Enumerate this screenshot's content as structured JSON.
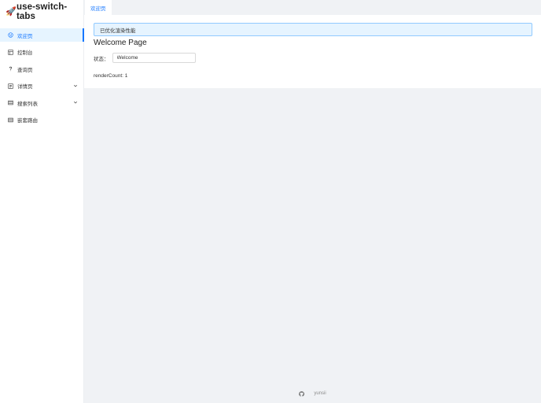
{
  "app": {
    "logo_emoji": "🚀",
    "title": "use-switch-tabs"
  },
  "sidebar": {
    "items": [
      {
        "label": "欢迎页",
        "icon": "smile-icon",
        "active": true,
        "has_submenu": false
      },
      {
        "label": "控制台",
        "icon": "dashboard-icon",
        "active": false,
        "has_submenu": false
      },
      {
        "label": "查询页",
        "icon": "question-icon",
        "active": false,
        "has_submenu": false
      },
      {
        "label": "详情页",
        "icon": "profile-icon",
        "active": false,
        "has_submenu": true
      },
      {
        "label": "搜索列表",
        "icon": "table-icon",
        "active": false,
        "has_submenu": true
      },
      {
        "label": "嵌套路由",
        "icon": "table-icon",
        "active": false,
        "has_submenu": false
      }
    ]
  },
  "tabs": [
    {
      "label": "欢迎页",
      "active": true
    }
  ],
  "main": {
    "alert_text": "已优化渲染性能",
    "title": "Welcome Page",
    "status_label": "状态：",
    "status_value": "Welcome",
    "render_count_text": "renderCount: 1"
  },
  "footer": {
    "icon": "github-icon",
    "author": "yunsii"
  },
  "colors": {
    "primary": "#1677ff",
    "active_bg": "#e6f4ff",
    "page_bg": "#f0f2f5",
    "alert_border": "#91caff"
  }
}
